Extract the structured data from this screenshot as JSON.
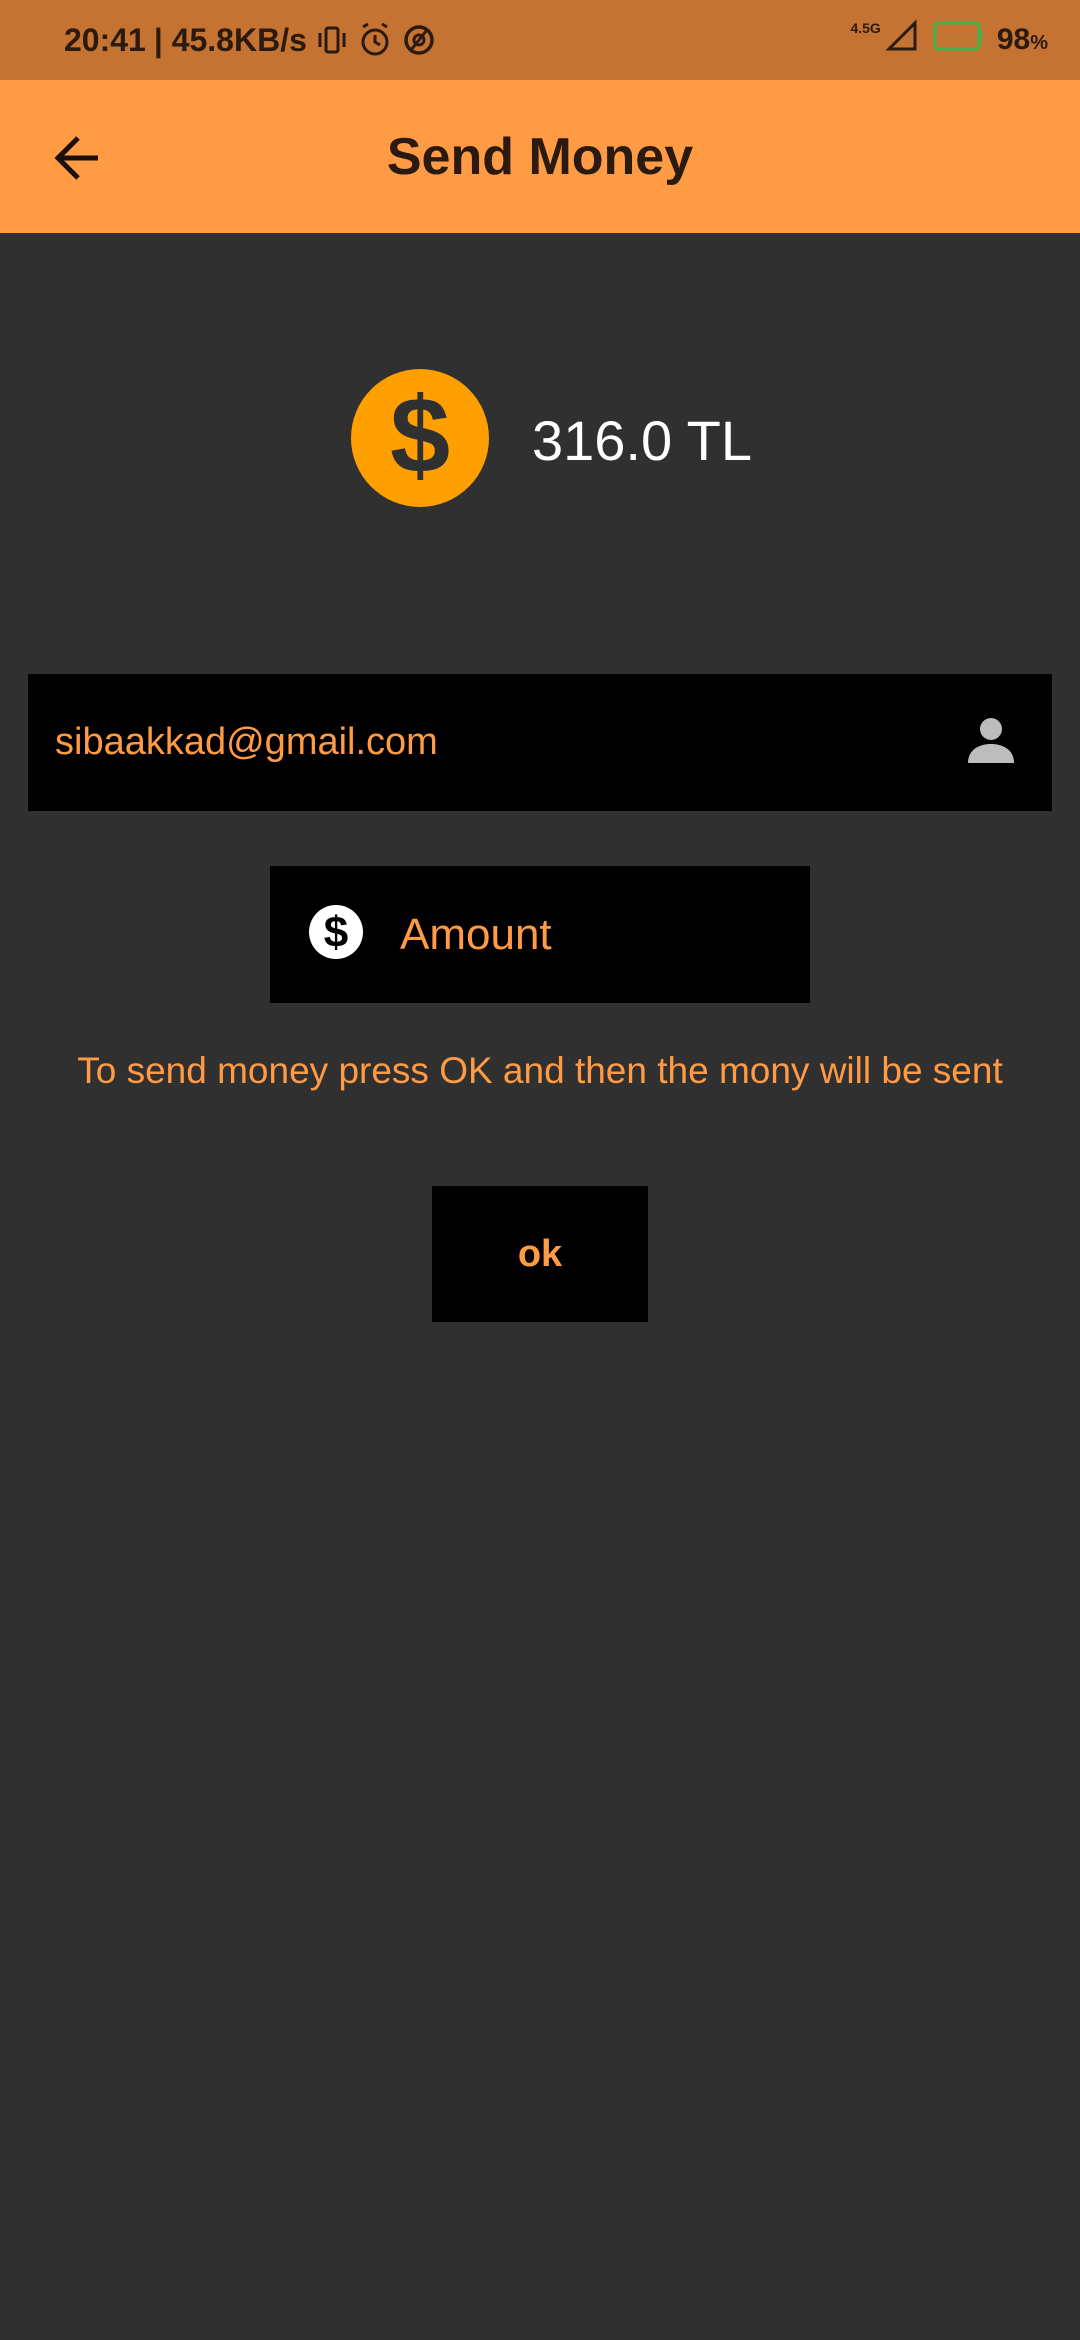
{
  "status_bar": {
    "time": "20:41",
    "network_speed": "| 45.8KB/s",
    "network_type": "4.5G",
    "battery_percent": "98",
    "battery_unit": "%"
  },
  "app_bar": {
    "title": "Send Money"
  },
  "balance": {
    "amount": "316.0 TL"
  },
  "form": {
    "email_value": "sibaakkad@gmail.com",
    "amount_placeholder": "Amount",
    "info_text": "To send money press OK and then the mony will be sent",
    "ok_label": "ok"
  },
  "colors": {
    "accent": "#ff9a45",
    "status_bar": "#c47332",
    "background": "#303030",
    "coin": "#ffa000"
  }
}
